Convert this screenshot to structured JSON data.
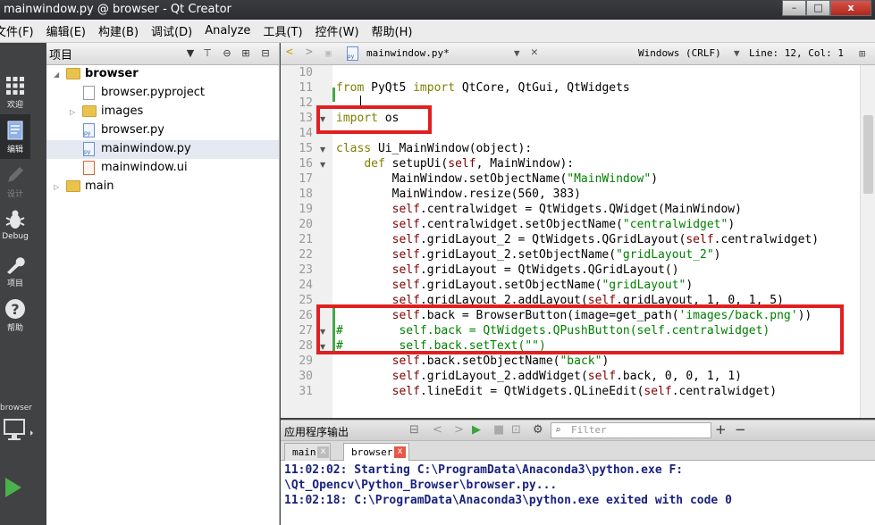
{
  "window": {
    "title": "mainwindow.py @ browser - Qt Creator",
    "buttons": {
      "minimize": "–",
      "maximize": "□",
      "close": "x"
    }
  },
  "menu": [
    "文件(F)",
    "编辑(E)",
    "构建(B)",
    "调试(D)",
    "Analyze",
    "工具(T)",
    "控件(W)",
    "帮助(H)"
  ],
  "modes": [
    {
      "label": "欢迎",
      "icon": "grid-icon"
    },
    {
      "label": "编辑",
      "icon": "edit-icon"
    },
    {
      "label": "设计",
      "icon": "pencil-icon"
    },
    {
      "label": "Debug",
      "icon": "bug-icon"
    },
    {
      "label": "项目",
      "icon": "wrench-icon"
    },
    {
      "label": "帮助",
      "icon": "help-icon"
    }
  ],
  "kit": {
    "label": "browser"
  },
  "project_pane": {
    "title": "项目",
    "tree": [
      {
        "label": "browser",
        "type": "folder",
        "level": 0,
        "expanded": true,
        "bold": true
      },
      {
        "label": "browser.pyproject",
        "type": "file",
        "level": 1
      },
      {
        "label": "images",
        "type": "folder",
        "level": 1,
        "expanded": false
      },
      {
        "label": "browser.py",
        "type": "py",
        "level": 1
      },
      {
        "label": "mainwindow.py",
        "type": "py",
        "level": 1,
        "selected": true
      },
      {
        "label": "mainwindow.ui",
        "type": "ui",
        "level": 1
      },
      {
        "label": "main",
        "type": "folder",
        "level": 0,
        "expanded": false
      }
    ]
  },
  "editor_toolbar": {
    "file_name": "mainwindow.py*",
    "encoding": "Windows (CRLF)",
    "position": "Line: 12, Col: 1"
  },
  "code": [
    {
      "n": "10",
      "text": ""
    },
    {
      "n": "11",
      "text": "from PyQt5 import QtCore, QtGui, QtWidgets"
    },
    {
      "n": "12",
      "text": ""
    },
    {
      "n": "13",
      "text": "import os",
      "fold": true
    },
    {
      "n": "14",
      "text": ""
    },
    {
      "n": "15",
      "text": "class Ui_MainWindow(object):",
      "fold": true
    },
    {
      "n": "16",
      "text": "    def setupUi(self, MainWindow):",
      "fold": true
    },
    {
      "n": "17",
      "text": "        MainWindow.setObjectName(\"MainWindow\")"
    },
    {
      "n": "18",
      "text": "        MainWindow.resize(560, 383)"
    },
    {
      "n": "19",
      "text": "        self.centralwidget = QtWidgets.QWidget(MainWindow)"
    },
    {
      "n": "20",
      "text": "        self.centralwidget.setObjectName(\"centralwidget\")"
    },
    {
      "n": "21",
      "text": "        self.gridLayout_2 = QtWidgets.QGridLayout(self.centralwidget)"
    },
    {
      "n": "22",
      "text": "        self.gridLayout_2.setObjectName(\"gridLayout_2\")"
    },
    {
      "n": "23",
      "text": "        self.gridLayout = QtWidgets.QGridLayout()"
    },
    {
      "n": "24",
      "text": "        self.gridLayout.setObjectName(\"gridLayout\")"
    },
    {
      "n": "25",
      "text": "        self.gridLayout_2.addLayout(self.gridLayout, 1, 0, 1, 5)"
    },
    {
      "n": "26",
      "text": "        self.back = BrowserButton(image=get_path('images/back.png'))"
    },
    {
      "n": "27",
      "text": "#        self.back = QtWidgets.QPushButton(self.centralwidget)",
      "fold": true
    },
    {
      "n": "28",
      "text": "#        self.back.setText(\"\")",
      "fold": true
    },
    {
      "n": "29",
      "text": "        self.back.setObjectName(\"back\")"
    },
    {
      "n": "30",
      "text": "        self.gridLayout_2.addWidget(self.back, 0, 0, 1, 1)"
    },
    {
      "n": "31",
      "text": "        self.lineEdit = QtWidgets.QLineEdit(self.centralwidget)"
    }
  ],
  "output": {
    "title": "应用程序输出",
    "filter_placeholder": "Filter",
    "tabs": [
      {
        "label": "main",
        "active": false
      },
      {
        "label": "browser",
        "active": true
      }
    ],
    "lines": [
      "11:02:02: Starting C:\\ProgramData\\Anaconda3\\python.exe F:",
      "\\Qt_Opencv\\Python_Browser\\browser.py...",
      "11:02:18: C:\\ProgramData\\Anaconda3\\python.exe exited with code 0"
    ]
  },
  "colors": {
    "highlight": "#e02020",
    "keyword": "#808000",
    "string": "#008000",
    "self": "#800000"
  }
}
